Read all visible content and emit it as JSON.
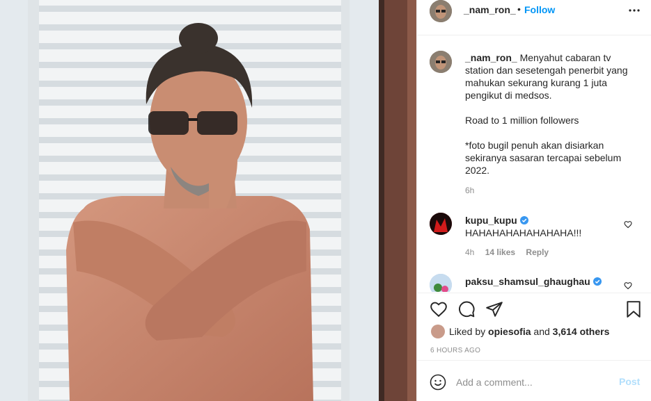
{
  "post": {
    "author": "_nam_ron_",
    "separator": "•",
    "follow_label": "Follow",
    "more_icon": "more-options-icon"
  },
  "caption": {
    "username": "_nam_ron_",
    "text": "Menyahut cabaran tv station dan sesetengah penerbit yang mahukan sekurang kurang 1 juta pengikut di medsos.\n\nRoad to 1 million followers\n\n*foto bugil penuh akan disiarkan sekiranya sasaran tercapai sebelum 2022.",
    "time": "6h"
  },
  "comments": [
    {
      "username": "kupu_kupu",
      "verified": true,
      "text": "HAHAHAHAHAHAHAHA!!!",
      "time": "4h",
      "likes": "14 likes",
      "reply": "Reply"
    },
    {
      "username": "paksu_shamsul_ghaughau",
      "verified": true
    }
  ],
  "likes": {
    "prefix": "Liked by",
    "first_user": "opiesofia",
    "connector": "and",
    "others": "3,614 others"
  },
  "timestamp": "6 HOURS AGO",
  "add_comment": {
    "placeholder": "Add a comment...",
    "post_label": "Post"
  },
  "colors": {
    "link_blue": "#0095f6",
    "post_disabled": "#b2dffc",
    "verified_blue": "#3897f0",
    "muted": "#8e8e8e"
  }
}
